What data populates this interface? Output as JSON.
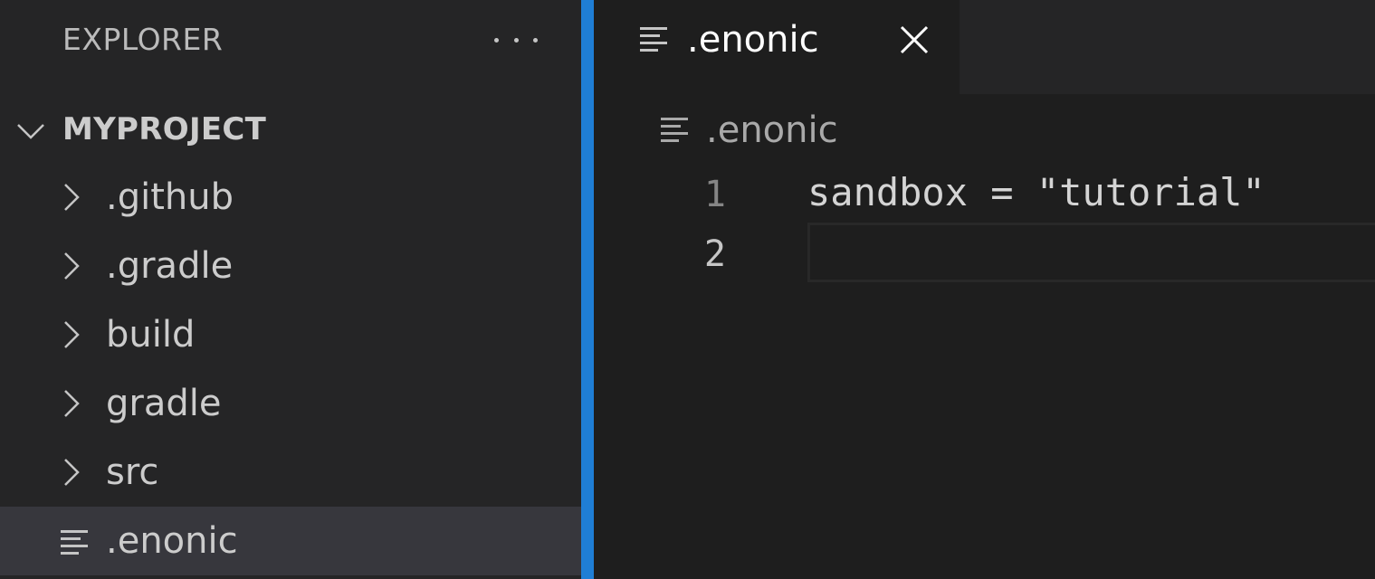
{
  "sidebar": {
    "title": "EXPLORER",
    "more_icon": "more-actions-icon",
    "project": {
      "name": "MYPROJECT",
      "expanded": true
    },
    "items": [
      {
        "label": ".github",
        "kind": "folder"
      },
      {
        "label": ".gradle",
        "kind": "folder"
      },
      {
        "label": "build",
        "kind": "folder"
      },
      {
        "label": "gradle",
        "kind": "folder"
      },
      {
        "label": "src",
        "kind": "folder"
      },
      {
        "label": ".enonic",
        "kind": "file",
        "selected": true
      }
    ]
  },
  "editor": {
    "tab": {
      "label": ".enonic",
      "close_icon": "close-icon"
    },
    "breadcrumb": {
      "label": ".enonic"
    },
    "lines": [
      {
        "number": "1",
        "text": "sandbox = \"tutorial\""
      },
      {
        "number": "2",
        "text": ""
      }
    ]
  },
  "colors": {
    "sidebar_bg": "#252526",
    "editor_bg": "#1e1e1e",
    "accent_border": "#1f7ed5",
    "selected_row": "#37373d"
  }
}
